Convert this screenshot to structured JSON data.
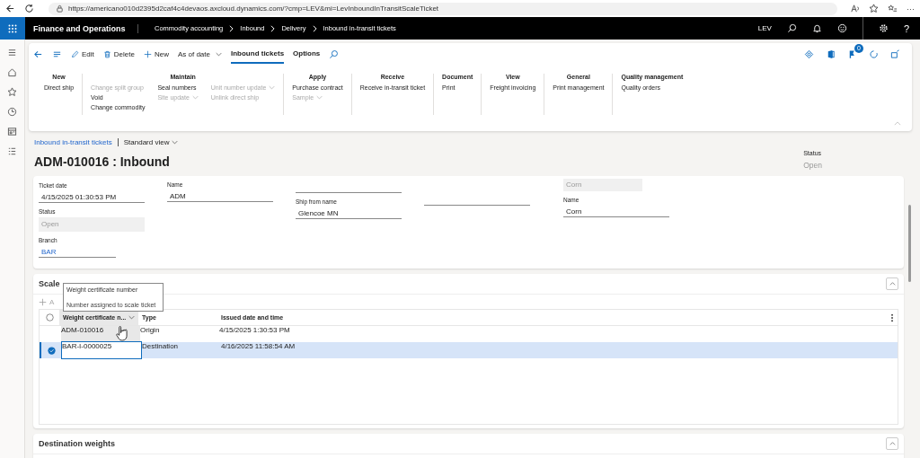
{
  "browser": {
    "url": "https://americano010d2395d2caf4c4devaos.axcloud.dynamics.com/?cmp=LEV&mi=LevInboundInTransitScaleTicket",
    "more": "···"
  },
  "app": {
    "title": "Finance and Operations",
    "breadcrumbs": [
      "Commodity accounting",
      "Inbound",
      "Delivery",
      "Inbound in-transit tickets"
    ],
    "company": "LEV",
    "help": "?"
  },
  "toolbar": {
    "edit": "Edit",
    "delete": "Delete",
    "new": "New",
    "as_of_date": "As of date",
    "tabs": [
      {
        "label": "Inbound tickets",
        "selected": true
      },
      {
        "label": "Options",
        "selected": false
      }
    ],
    "badge": "0"
  },
  "action_groups": [
    {
      "title": "New",
      "columns": [
        [
          {
            "label": "Direct ship",
            "disabled": false,
            "dropdown": false
          }
        ]
      ]
    },
    {
      "title": "Maintain",
      "columns": [
        [
          {
            "label": "Change split group",
            "disabled": true,
            "dropdown": false
          },
          {
            "label": "Void",
            "disabled": false,
            "dropdown": false
          },
          {
            "label": "Change commodity",
            "disabled": false,
            "dropdown": false
          }
        ],
        [
          {
            "label": "Seal numbers",
            "disabled": false,
            "dropdown": false
          },
          {
            "label": "Site update",
            "disabled": true,
            "dropdown": true
          }
        ],
        [
          {
            "label": "Unit number update",
            "disabled": true,
            "dropdown": true
          },
          {
            "label": "Unlink direct ship",
            "disabled": true,
            "dropdown": false
          }
        ]
      ]
    },
    {
      "title": "Apply",
      "columns": [
        [
          {
            "label": "Purchase contract",
            "disabled": false,
            "dropdown": false
          },
          {
            "label": "Sample",
            "disabled": true,
            "dropdown": true
          }
        ]
      ]
    },
    {
      "title": "Receive",
      "columns": [
        [
          {
            "label": "Receive in-transit ticket",
            "disabled": false,
            "dropdown": false
          }
        ]
      ]
    },
    {
      "title": "Document",
      "columns": [
        [
          {
            "label": "Print",
            "disabled": false,
            "dropdown": false
          }
        ]
      ]
    },
    {
      "title": "View",
      "columns": [
        [
          {
            "label": "Freight invoicing",
            "disabled": false,
            "dropdown": false
          }
        ]
      ]
    },
    {
      "title": "General",
      "columns": [
        [
          {
            "label": "Print management",
            "disabled": false,
            "dropdown": false
          }
        ]
      ]
    },
    {
      "title": "Quality management",
      "columns": [
        [
          {
            "label": "Quality orders",
            "disabled": false,
            "dropdown": false
          }
        ]
      ]
    }
  ],
  "page": {
    "nav_link": "Inbound in-transit tickets",
    "view": "Standard view",
    "title": "ADM-010016 : Inbound",
    "status_label": "Status",
    "status_value": "Open"
  },
  "form_columns": [
    [
      {
        "label": "Ticket date",
        "value": "4/15/2025 01:30:53 PM",
        "kind": "input"
      },
      {
        "label": "Status",
        "value": "Open",
        "kind": "readonly"
      },
      {
        "label": "Branch",
        "value": "BAR",
        "kind": "link"
      }
    ],
    [
      {
        "label": "Name",
        "value": "ADM",
        "kind": "input"
      }
    ],
    [
      {
        "kind": "input"
      },
      {
        "label": "Ship from name",
        "value": "Glencoe MN",
        "kind": "input"
      }
    ],
    [
      {
        "kind": "input"
      }
    ],
    [
      {
        "value": "Corn",
        "kind": "readonly"
      },
      {
        "label": "Name",
        "value": "Corn",
        "kind": "input"
      }
    ]
  ],
  "scale_certificates": {
    "title": "Scale",
    "add_label": "A",
    "tooltip": {
      "title": "Weight certificate number",
      "text": "Number assigned to scale ticket"
    },
    "columns": [
      "Weight certificate n...",
      "Type",
      "Issued date and time"
    ],
    "rows": [
      {
        "cells": [
          "ADM-010016",
          "Origin",
          "4/15/2025 1:30:53 PM"
        ],
        "selected": false
      },
      {
        "cells": [
          "BAR-I-0000025",
          "Destination",
          "4/16/2025 11:58:54 AM"
        ],
        "selected": true
      }
    ]
  },
  "destination_weights": {
    "title": "Destination weights"
  }
}
